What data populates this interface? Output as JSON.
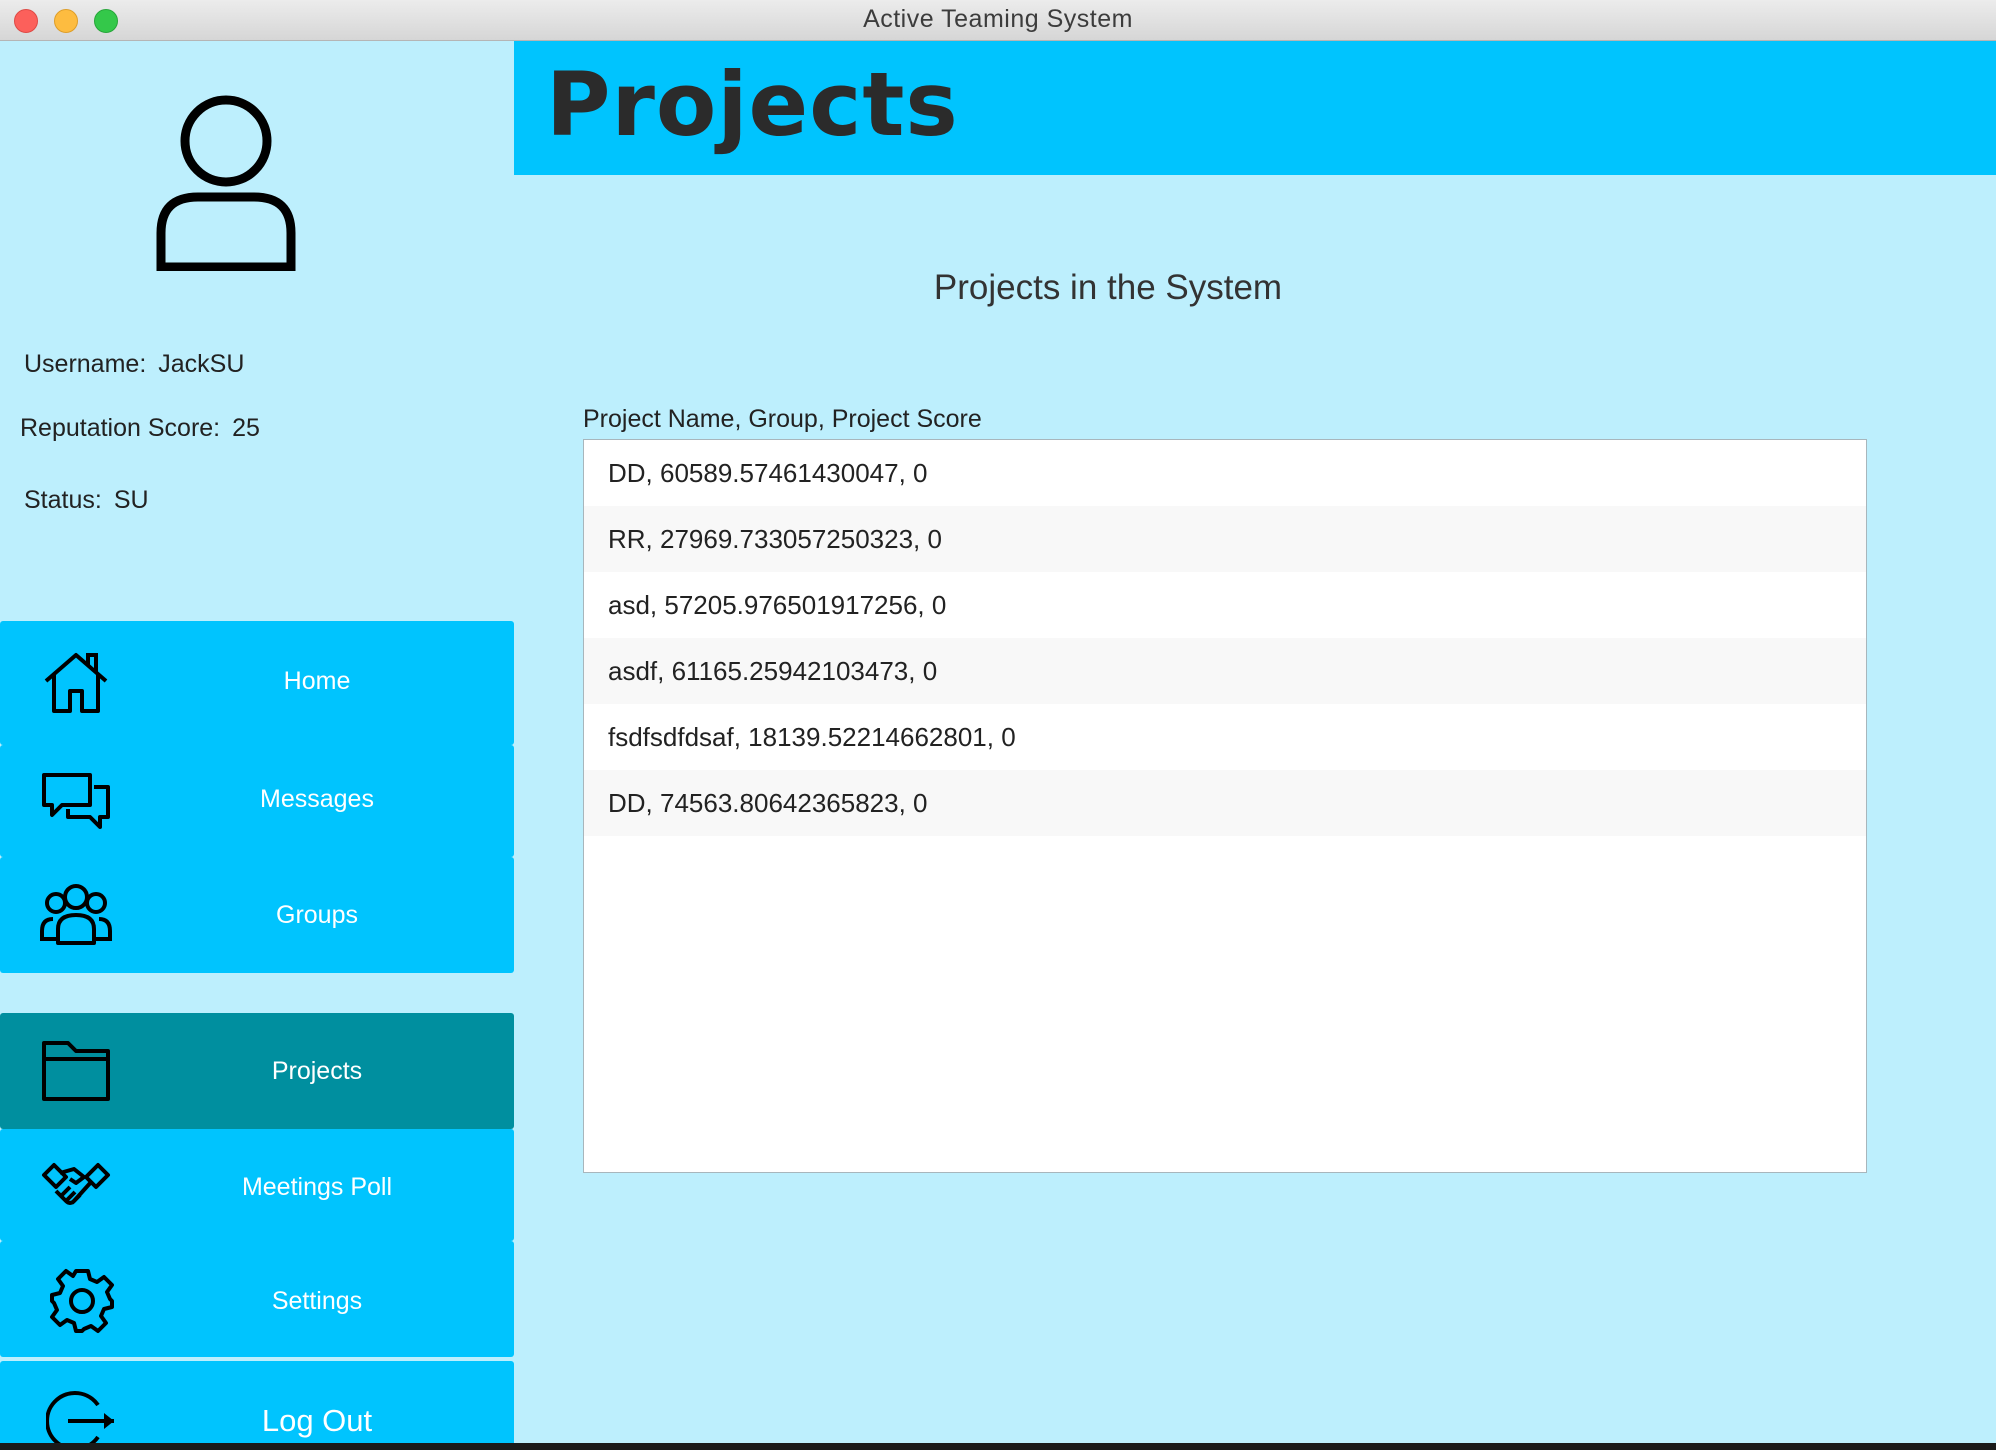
{
  "window": {
    "title": "Active Teaming System"
  },
  "profile": {
    "username_label": "Username:",
    "username": "JackSU",
    "reputation_label": "Reputation Score:",
    "reputation": "25",
    "status_label": "Status:",
    "status": "SU"
  },
  "nav": {
    "items": [
      {
        "label": "Home",
        "icon": "home-icon"
      },
      {
        "label": "Messages",
        "icon": "chat-bubbles-icon"
      },
      {
        "label": "Groups",
        "icon": "users-icon"
      },
      {
        "label": "Projects",
        "icon": "folder-icon",
        "active": true
      },
      {
        "label": "Meetings Poll",
        "icon": "handshake-icon"
      },
      {
        "label": "Settings",
        "icon": "gear-icon"
      },
      {
        "label": "Log Out",
        "icon": "logout-icon"
      }
    ]
  },
  "header": {
    "title": "Projects"
  },
  "main": {
    "subtitle": "Projects in the System",
    "list_label": "Project Name, Group, Project Score",
    "rows": [
      "DD, 60589.57461430047, 0",
      "RR, 27969.733057250323, 0",
      "asd, 57205.976501917256, 0",
      "asdf, 61165.25942103473, 0",
      "fsdfsdfdsaf, 18139.52214662801, 0",
      "DD, 74563.80642365823, 0"
    ]
  },
  "colors": {
    "accent": "#00c4fe",
    "active": "#008f9f",
    "background": "#bdeffd"
  }
}
